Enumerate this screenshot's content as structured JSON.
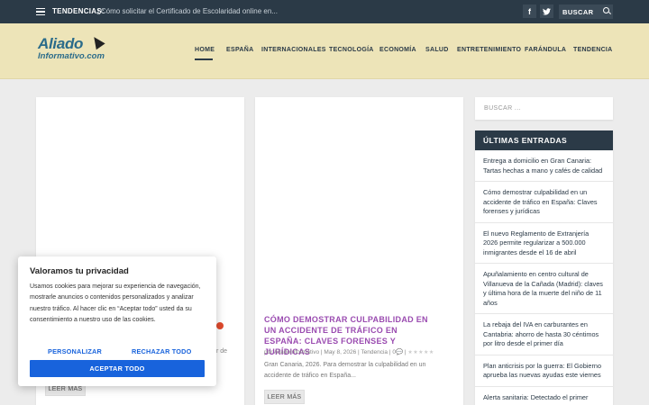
{
  "topbar": {
    "trending_label": "TENDENCIAS:",
    "trending_text": "¿Cómo solicitar el Certificado de Escolaridad online en...",
    "facebook": "f",
    "twitter": "t",
    "search_placeholder": "BUSCAR"
  },
  "logo": {
    "line1": "Aliado",
    "line2": "Informativo.com"
  },
  "nav": {
    "items": [
      "HOME",
      "ESPAÑA",
      "INTERNACIONALES",
      "TECNOLOGÍA",
      "ECONOMÍA",
      "SALUD",
      "ENTRETENIMIENTO",
      "FARÁNDULA",
      "TENDENCIA"
    ],
    "active": "HOME"
  },
  "card1": {
    "peek_text": "r de",
    "read_more": "LEER MÁS"
  },
  "card2": {
    "title": "CÓMO DEMOSTRAR CULPABILIDAD EN UN ACCIDENTE DE TRÁFICO EN ESPAÑA: CLAVES FORENSES Y JURÍDICAS",
    "author_prefix": "por",
    "author": "AliadoInformativo",
    "date": "May 8, 2026",
    "category": "Tendencia",
    "comments": "0",
    "excerpt": "Gran Canaria, 2026. Para demostrar la culpabilidad en un accidente de tráfico en España...",
    "read_more": "LEER MÁS"
  },
  "sidebar": {
    "search_placeholder": "BUSCAR ...",
    "heading": "ÚLTIMAS ENTRADAS",
    "entries": [
      "Entrega a domicilio en Gran Canaria: Tartas hechas a mano y cafés de calidad",
      "Cómo demostrar culpabilidad en un accidente de tráfico en España: Claves forenses y jurídicas",
      "El nuevo Reglamento de Extranjería 2026 permite regularizar a 500.000 inmigrantes desde el 16 de abril",
      "Apuñalamiento en centro cultural de Villanueva de la Cañada (Madrid): claves y última hora de la muerte del niño de 11 años",
      "La rebaja del IVA en carburantes en Cantabria: ahorro de hasta 30 céntimos por litro desde el primer día",
      "Plan anticrisis por la guerra: El Gobierno aprueba las nuevas ayudas este viernes",
      "Alerta sanitaria: Detectado el primer"
    ]
  },
  "cookie": {
    "title": "Valoramos tu privacidad",
    "body": "Usamos cookies para mejorar su experiencia de navegación, mostrarle anuncios o contenidos personalizados y analizar nuestro tráfico. Al hacer clic en “Aceptar todo” usted da su consentimiento a nuestro uso de las cookies.",
    "customize": "PERSONALIZAR",
    "reject": "RECHAZAR TODO",
    "accept": "ACEPTAR TODO"
  }
}
